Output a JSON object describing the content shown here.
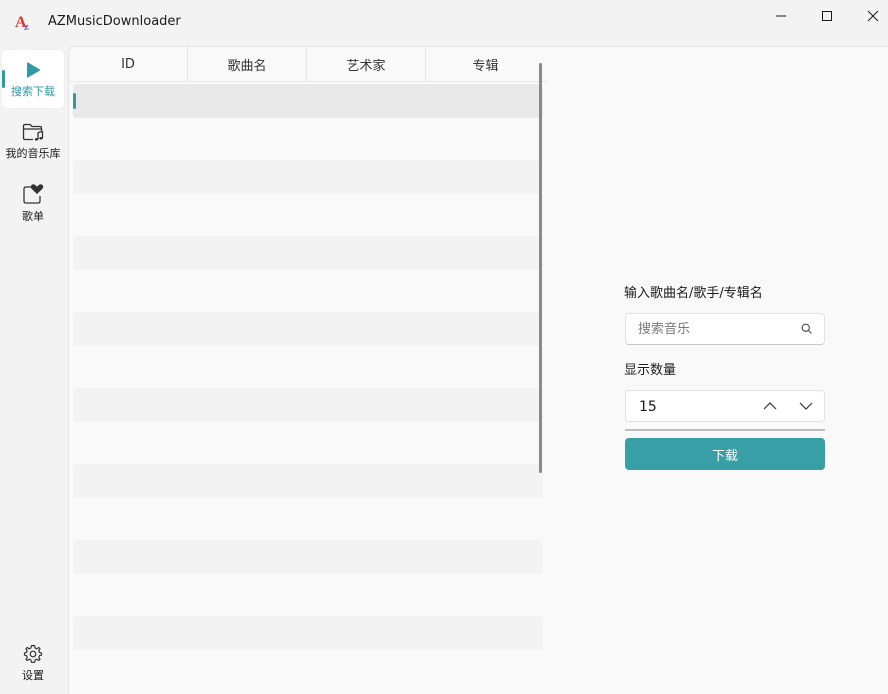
{
  "window": {
    "title": "AZMusicDownloader"
  },
  "sidebar": {
    "items": [
      {
        "label": "搜索下载",
        "icon": "play-icon",
        "active": true
      },
      {
        "label": "我的音乐库",
        "icon": "music-folder-icon",
        "active": false
      },
      {
        "label": "歌单",
        "icon": "heart-playlist-icon",
        "active": false
      }
    ],
    "settings": {
      "label": "设置",
      "icon": "gear-icon"
    }
  },
  "table": {
    "columns": [
      "ID",
      "歌曲名",
      "艺术家",
      "专辑"
    ],
    "rows": []
  },
  "search": {
    "label": "输入歌曲名/歌手/专辑名",
    "placeholder": "搜索音乐",
    "value": ""
  },
  "count": {
    "label": "显示数量",
    "value": "15"
  },
  "download": {
    "label": "下载"
  },
  "colors": {
    "accent": "#389fa6",
    "background": "#f3f3f3"
  }
}
